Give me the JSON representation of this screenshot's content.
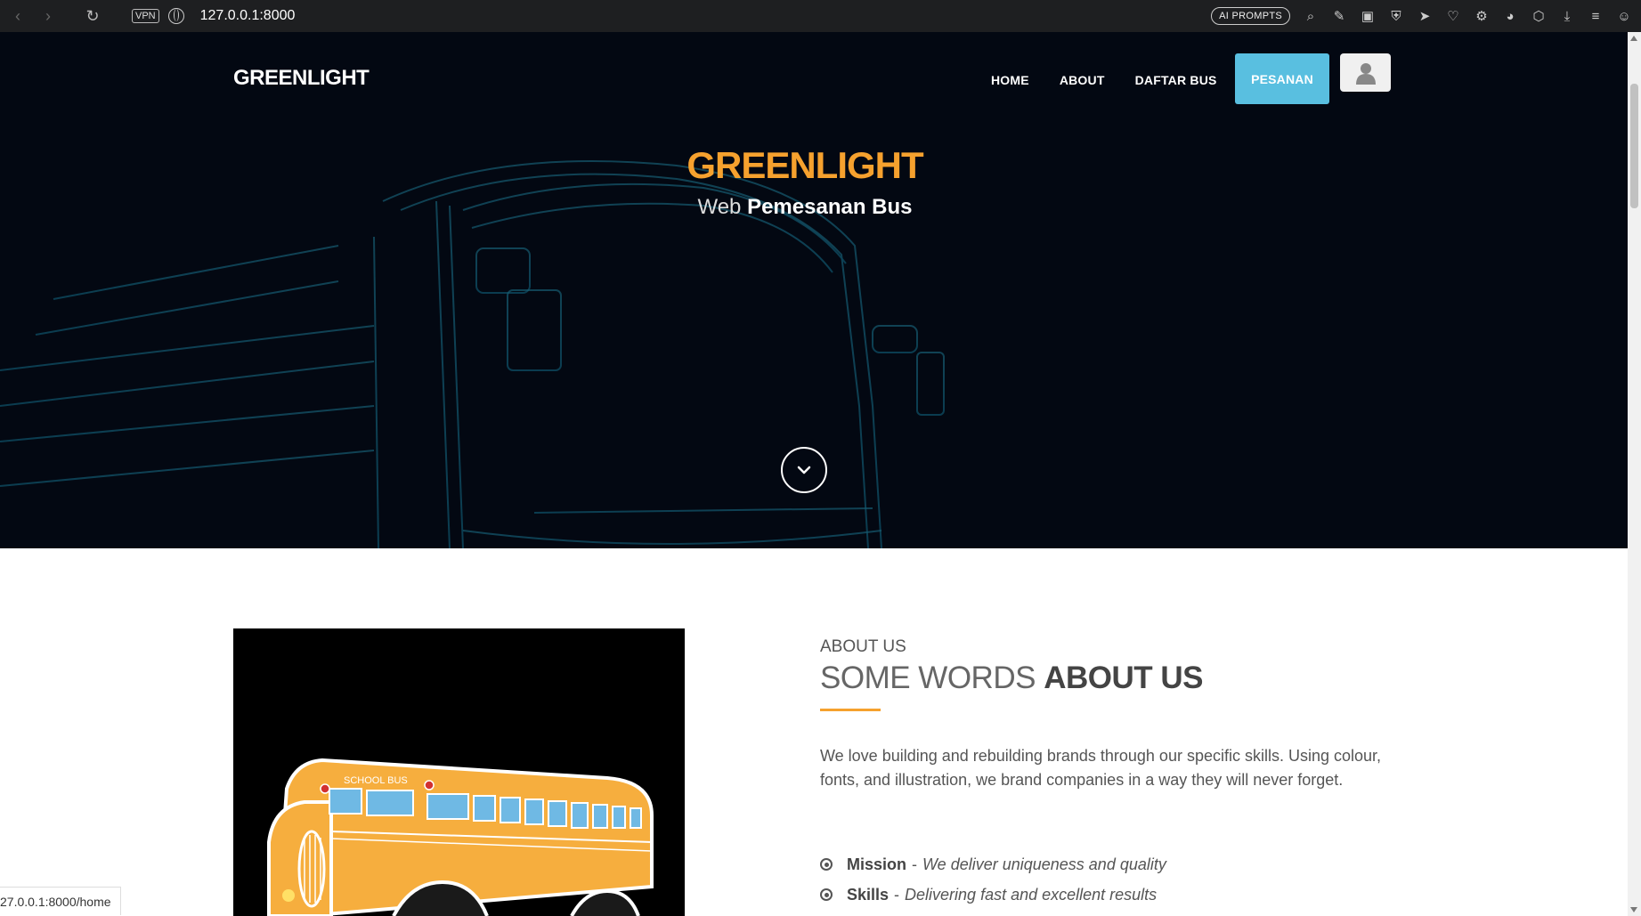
{
  "browser": {
    "url": "127.0.0.1:8000",
    "vpn_label": "VPN",
    "ai_prompts_label": "AI PROMPTS",
    "status_url": "27.0.0.1:8000/home"
  },
  "navbar": {
    "brand": "GREENLIGHT",
    "items": [
      {
        "label": "HOME"
      },
      {
        "label": "ABOUT"
      },
      {
        "label": "DAFTAR BUS"
      }
    ],
    "cta_label": "PESANAN"
  },
  "hero": {
    "title": "GREENLIGHT",
    "subtitle_light": "Web",
    "subtitle_bold": "Pemesanan Bus"
  },
  "about": {
    "eyebrow": "ABOUT US",
    "heading_light": "SOME WORDS",
    "heading_bold": "ABOUT US",
    "body": "We love building and rebuilding brands through our specific skills. Using colour, fonts, and illustration, we brand companies in a way they will never forget.",
    "list": [
      {
        "term": "Mission",
        "sep": "-",
        "desc": "We deliver uniqueness and quality"
      },
      {
        "term": "Skills",
        "sep": "-",
        "desc": "Delivering fast and excellent results"
      }
    ],
    "image_label": "SCHOOL BUS"
  },
  "colors": {
    "accent_orange": "#f6a12e",
    "cta_blue": "#59bfe0",
    "hero_bg": "#030812"
  }
}
